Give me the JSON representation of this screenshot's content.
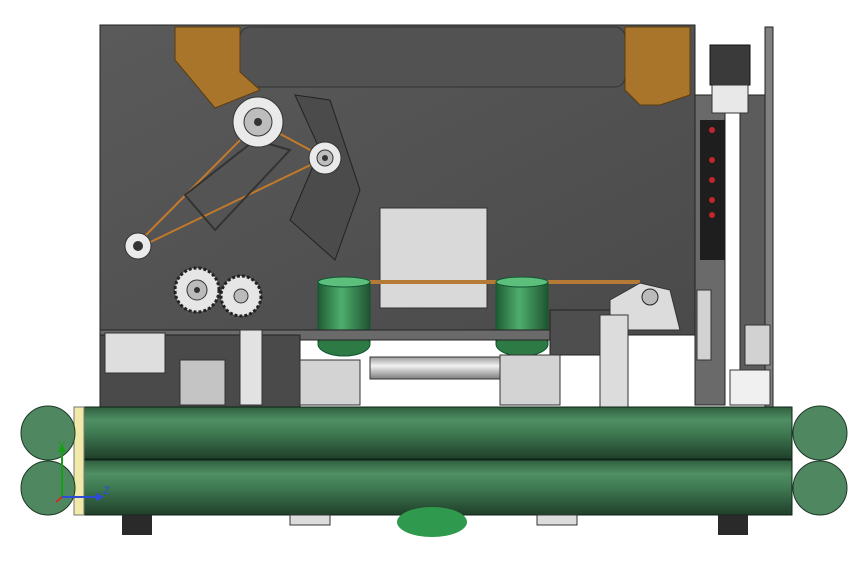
{
  "viewport": {
    "background": "#ffffff",
    "colors": {
      "plate": "#575757",
      "plate_dark": "#3e3e3e",
      "bronze": "#a8752b",
      "roller": "#3f7a52",
      "cylinder": "#3c8f56",
      "steel": "#d6d6d6"
    }
  },
  "triad": {
    "y_label": "Y",
    "z_label": "Z",
    "y_color": "#16a016",
    "z_color": "#2d4bd6",
    "x_color": "#d22a2a"
  }
}
